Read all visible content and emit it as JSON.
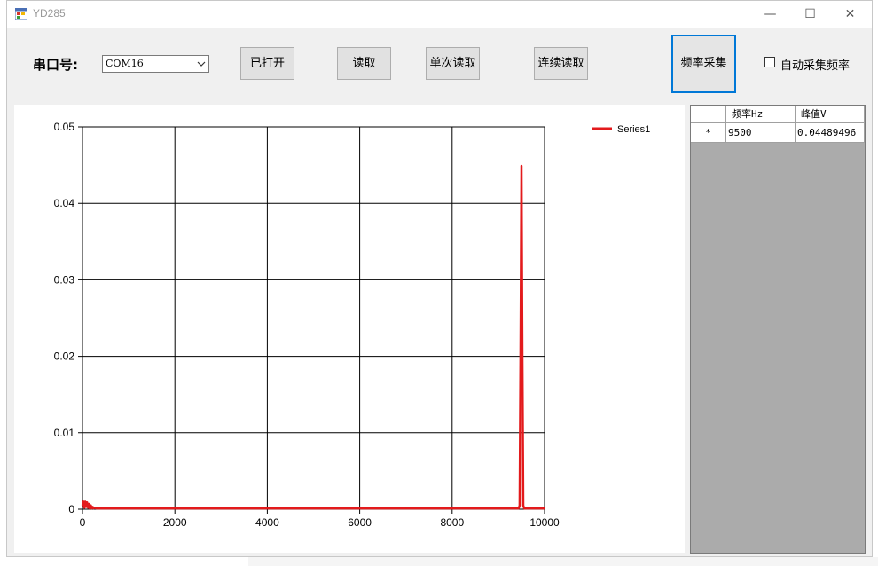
{
  "window": {
    "title": "YD285",
    "minimize_glyph": "—",
    "maximize_glyph": "☐",
    "close_glyph": "✕"
  },
  "toolbar": {
    "port_label": "串口号:",
    "port_value": "COM16",
    "open_button": "已打开",
    "read_button": "读取",
    "single_read_button": "单次读取",
    "continuous_read_button": "连续读取",
    "freq_collect_button": "频率采集",
    "auto_collect_label": "自动采集频率",
    "auto_collect_checked": false
  },
  "grid": {
    "columns": [
      "频率Hz",
      "峰值V"
    ],
    "row_marker": "*",
    "rows": [
      {
        "freq": "9500",
        "peak": "0.04489496"
      }
    ]
  },
  "colors": {
    "series": "#e31a1c",
    "window_bg": "#f0f0f0",
    "accent_border": "#0078d7"
  },
  "chart_data": {
    "type": "line",
    "title": "",
    "xlabel": "",
    "ylabel": "",
    "xlim": [
      0,
      10000
    ],
    "ylim": [
      0,
      0.05
    ],
    "x_ticks": [
      "0",
      "2000",
      "4000",
      "6000",
      "8000",
      "10000"
    ],
    "y_ticks": [
      "0",
      "0.01",
      "0.02",
      "0.03",
      "0.04",
      "0.05"
    ],
    "grid": true,
    "legend_position": "top-right",
    "series": [
      {
        "name": "Series1",
        "color": "#e31a1c",
        "x": [
          0,
          20,
          40,
          60,
          80,
          100,
          120,
          140,
          160,
          180,
          200,
          220,
          240,
          260,
          300,
          400,
          1000,
          2000,
          3000,
          4000,
          5000,
          6000,
          7000,
          8000,
          9000,
          9440,
          9460,
          9480,
          9500,
          9520,
          9540,
          9560,
          10000
        ],
        "y": [
          0.0005,
          0.001,
          0.0002,
          0.001,
          0.0003,
          0.0009,
          0.0002,
          0.0007,
          0.0001,
          0.0005,
          0.0001,
          0.0003,
          0.0001,
          0.0002,
          0.0001,
          0.0001,
          0.0001,
          0.0001,
          0.0001,
          0.0001,
          0.0001,
          0.0001,
          0.0001,
          0.0001,
          0.0001,
          0.0001,
          0.0005,
          0.02,
          0.04489496,
          0.02,
          0.0005,
          0.0001,
          0.0001
        ]
      }
    ]
  }
}
